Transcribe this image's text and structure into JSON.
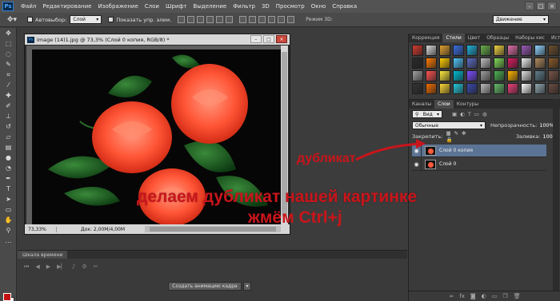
{
  "app": {
    "logo": "Ps"
  },
  "menu": [
    "Файл",
    "Редактирование",
    "Изображение",
    "Слои",
    "Шрифт",
    "Выделение",
    "Фильтр",
    "3D",
    "Просмотр",
    "Окно",
    "Справка"
  ],
  "window_controls": [
    "–",
    "□",
    "×"
  ],
  "options_bar": {
    "autoselect_label": "Автовыбор:",
    "autoselect_value": "Слой",
    "show_controls_label": "Показать упр. элем.",
    "mode3d_label": "Режим 3D:",
    "workspace": "Движение"
  },
  "document": {
    "title": "image (14)1.jpg @ 73,3% (Слой 0 копия, RGB/8) *",
    "zoom": "73,33%",
    "doc_info": "Док: 2,00M/4,00M"
  },
  "right_panel": {
    "top_tabs": [
      "Коррекция",
      "Стили",
      "Цвет",
      "Образцы",
      "Наборы кис",
      "История"
    ],
    "active_top_tab": "Стили",
    "style_colors": [
      "#d23a2e",
      "#d8d8d8",
      "#e0a030",
      "#3a6ee0",
      "#20b0d8",
      "#6ab04c",
      "#f0d040",
      "#e06fa8",
      "#9b59b6",
      "#8fd3ff",
      "#6b4e2e",
      "#2a2a2a",
      "#ff7a00",
      "#ffcc00",
      "#4fc3f7",
      "#5c6bc0",
      "#c0c0c0",
      "#7ed957",
      "#d81b60",
      "#f0f0f0",
      "#b0895e",
      "#8a5a2a",
      "#a0a0a0",
      "#ff5252",
      "#ffeb3b",
      "#00bcd4",
      "#7c4dff",
      "#9e9e9e",
      "#4caf50",
      "#ffb300",
      "#e0e0e0",
      "#607d8b",
      "#795548",
      "#333333",
      "#ef6c00",
      "#fdd835",
      "#26c6da",
      "#3949ab",
      "#bdbdbd",
      "#66bb6a",
      "#ec407a",
      "#ffffff",
      "#90a4ae",
      "#6d4c41"
    ],
    "layer_tabs": [
      "Каналы",
      "Слои",
      "Контуры"
    ],
    "active_layer_tab": "Слои",
    "kind_filter": "Вид",
    "blend_mode": "Обычные",
    "opacity_label": "Непрозрачность:",
    "opacity_value": "100%",
    "lock_label": "Закрепить:",
    "fill_label": "Заливка:",
    "fill_value": "100%",
    "layers": [
      {
        "name": "Слой 0 копия",
        "selected": true
      },
      {
        "name": "Слой 0",
        "selected": false
      }
    ]
  },
  "timeline": {
    "tab": "Шкала времени",
    "create_button": "Создать анимацию кадра"
  },
  "annotations": {
    "duplicate": "дубликат",
    "line1": "делаем дубликат нашей картинке",
    "line2": "жмём Ctrl+j"
  }
}
